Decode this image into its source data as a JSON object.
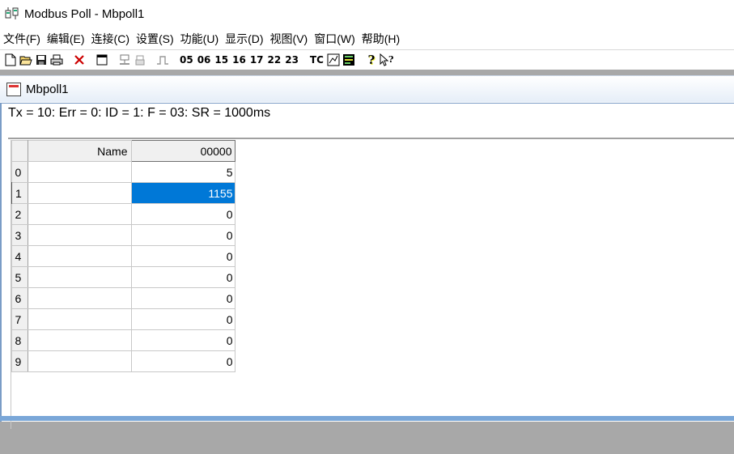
{
  "window": {
    "title": "Modbus Poll - Mbpoll1"
  },
  "menu": [
    {
      "label": "文件(F)"
    },
    {
      "label": "编辑(E)"
    },
    {
      "label": "连接(C)"
    },
    {
      "label": "设置(S)"
    },
    {
      "label": "功能(U)"
    },
    {
      "label": "显示(D)"
    },
    {
      "label": "视图(V)"
    },
    {
      "label": "窗口(W)"
    },
    {
      "label": "帮助(H)"
    }
  ],
  "toolbar": {
    "icons": [
      "new-icon",
      "open-icon",
      "save-icon",
      "print-icon",
      "delete-icon",
      "window-icon",
      "connect-icon",
      "disconnect-icon",
      "pulse-icon",
      "chart-icon",
      "communication-icon",
      "help-icon",
      "context-help-icon"
    ],
    "function_codes": [
      "05",
      "06",
      "15",
      "16",
      "17",
      "22",
      "23"
    ],
    "tc_label": "TC"
  },
  "child": {
    "title": "Mbpoll1",
    "status_line": "Tx = 10: Err = 0: ID = 1: F = 03: SR = 1000ms"
  },
  "grid": {
    "col_name_header": "Name",
    "col_value_header": "00000",
    "selected_row": 1,
    "rows": [
      {
        "index": "0",
        "name": "",
        "value": "5"
      },
      {
        "index": "1",
        "name": "",
        "value": "1155"
      },
      {
        "index": "2",
        "name": "",
        "value": "0"
      },
      {
        "index": "3",
        "name": "",
        "value": "0"
      },
      {
        "index": "4",
        "name": "",
        "value": "0"
      },
      {
        "index": "5",
        "name": "",
        "value": "0"
      },
      {
        "index": "6",
        "name": "",
        "value": "0"
      },
      {
        "index": "7",
        "name": "",
        "value": "0"
      },
      {
        "index": "8",
        "name": "",
        "value": "0"
      },
      {
        "index": "9",
        "name": "",
        "value": "0"
      }
    ]
  },
  "colors": {
    "selection": "#0078d7",
    "mdi_background": "#a8a8a8",
    "frame_border": "#7a9cc6"
  }
}
